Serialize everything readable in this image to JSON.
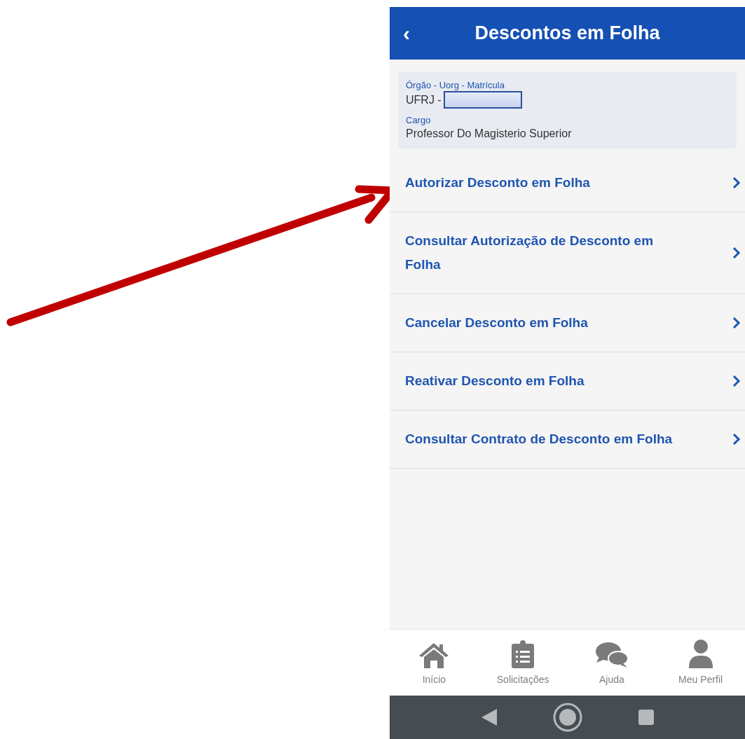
{
  "header": {
    "back": "‹",
    "title": "Descontos em Folha"
  },
  "info_card": {
    "fields": [
      {
        "label": "Órgão - Uorg - Matrícula",
        "value": "UFRJ -",
        "redacted": true
      },
      {
        "label": "Cargo",
        "value": "Professor Do Magisterio Superior",
        "redacted": false
      }
    ]
  },
  "menu_items": [
    {
      "label": "Autorizar Desconto em Folha"
    },
    {
      "label": "Consultar Autorização de Desconto em Folha"
    },
    {
      "label": "Cancelar Desconto em Folha"
    },
    {
      "label": "Reativar Desconto em Folha"
    },
    {
      "label": "Consultar Contrato de Desconto em Folha"
    }
  ],
  "bottom_nav": [
    {
      "label": "Início"
    },
    {
      "label": "Solicitações"
    },
    {
      "label": "Ajuda"
    },
    {
      "label": "Meu Perfil"
    }
  ]
}
